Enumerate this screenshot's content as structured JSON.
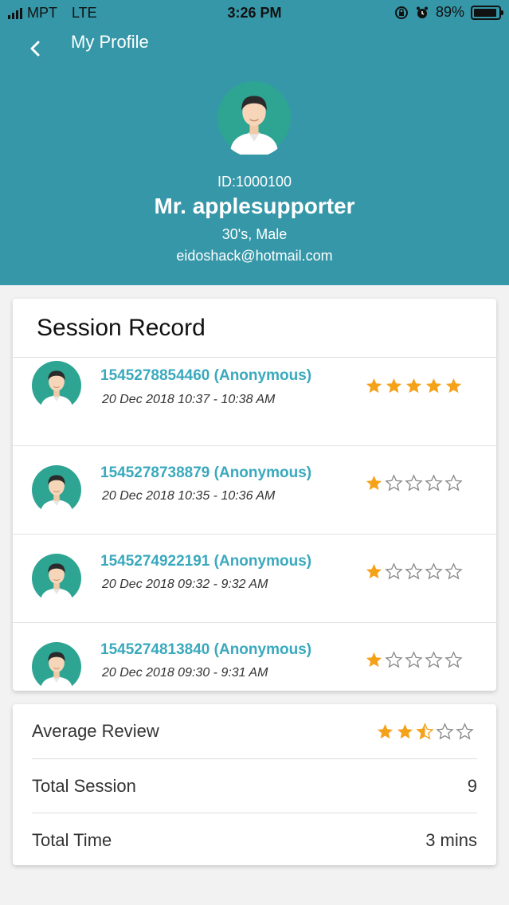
{
  "status_bar": {
    "carrier": "MPT",
    "network": "LTE",
    "time": "3:26 PM",
    "battery": "89%"
  },
  "nav": {
    "title": "My Profile",
    "back_icon": "chevron-left-icon"
  },
  "profile": {
    "id": "ID:1000100",
    "name": "Mr. applesupporter",
    "meta": "30's, Male",
    "email": "eidoshack@hotmail.com"
  },
  "sessions": {
    "title": "Session Record",
    "items": [
      {
        "id": "1545278854460 (Anonymous)",
        "time": "20 Dec 2018 10:37 - 10:38 AM",
        "rating": 5
      },
      {
        "id": "1545278738879 (Anonymous)",
        "time": "20 Dec 2018 10:35 - 10:36 AM",
        "rating": 1
      },
      {
        "id": "1545274922191 (Anonymous)",
        "time": "20 Dec 2018 09:32 - 9:32 AM",
        "rating": 1
      },
      {
        "id": "1545274813840 (Anonymous)",
        "time": "20 Dec 2018 09:30 - 9:31 AM",
        "rating": 1
      }
    ]
  },
  "summary": {
    "average_label": "Average Review",
    "average_rating": 2.5,
    "total_session_label": "Total Session",
    "total_session_value": "9",
    "total_time_label": "Total Time",
    "total_time_value": "3 mins"
  },
  "colors": {
    "header": "#3597a8",
    "link": "#3aa9bd",
    "star": "#f5a21b",
    "avatar_bg": "#2ea593"
  }
}
